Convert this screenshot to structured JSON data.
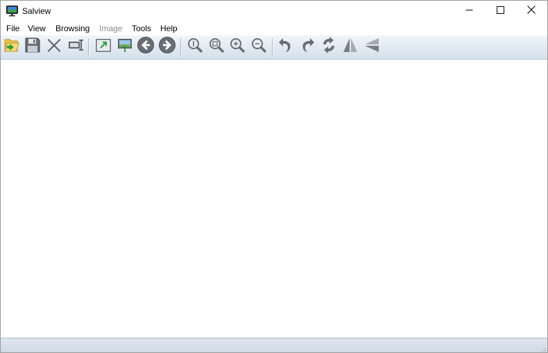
{
  "window": {
    "title": "Salview",
    "icon": "monitor-app-icon"
  },
  "caption_buttons": {
    "minimize": "minimize-icon",
    "maximize": "maximize-icon",
    "close": "close-icon"
  },
  "menu": {
    "items": [
      {
        "label": "File",
        "enabled": true
      },
      {
        "label": "View",
        "enabled": true
      },
      {
        "label": "Browsing",
        "enabled": true
      },
      {
        "label": "Image",
        "enabled": false
      },
      {
        "label": "Tools",
        "enabled": true
      },
      {
        "label": "Help",
        "enabled": true
      }
    ]
  },
  "toolbar": {
    "buttons": [
      "open-folder-icon",
      "save-icon",
      "delete-icon",
      "slideshow-icon",
      "export-icon",
      "set-wallpaper-icon",
      "previous-icon",
      "next-icon",
      "actual-size-icon",
      "fit-to-window-icon",
      "zoom-in-icon",
      "zoom-out-icon",
      "rotate-left-icon",
      "rotate-right-icon",
      "rotate-180-icon",
      "flip-horizontal-icon",
      "flip-vertical-icon"
    ]
  },
  "colors": {
    "toolbar_gradient_top": "#f2f6fa",
    "toolbar_gradient_bottom": "#d6e1ec",
    "statusbar": "#d5dee8",
    "disabled_menu_text": "#8a8a8a"
  }
}
